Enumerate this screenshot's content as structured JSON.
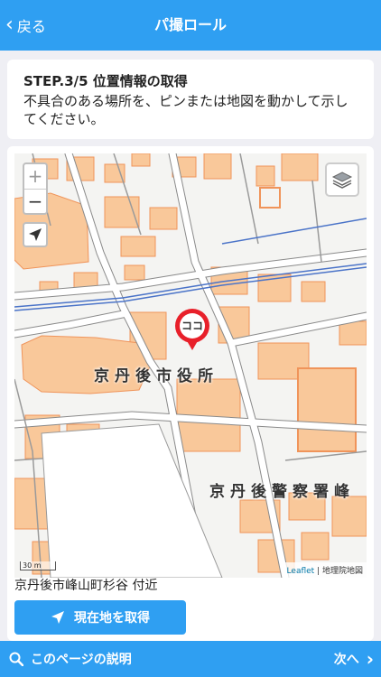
{
  "nav": {
    "back_label": "戻る",
    "title": "パ撮ロール"
  },
  "step": {
    "title": "STEP.3/5 位置情報の取得",
    "description": "不具合のある場所を、ピンまたは地図を動かして示してください。"
  },
  "map": {
    "zoom_in": "+",
    "zoom_out": "−",
    "marker_label": "ココ",
    "labels": {
      "city_hall": "京丹後市役所",
      "police": "京丹後警察署峰"
    },
    "scale_label": "30 m",
    "attribution_leaflet": "Leaflet",
    "attribution_gsi": "地理院地図",
    "colors": {
      "building": "#f9c89a",
      "building_edge": "#f0945a",
      "road": "#ffffff",
      "water": "#4a73c8"
    }
  },
  "address": "京丹後市峰山町杉谷 付近",
  "locate_button_label": "現在地を取得",
  "footer": {
    "help_label": "このページの説明",
    "next_label": "次へ"
  },
  "colors": {
    "accent": "#2f9ff2",
    "marker": "#e8202a"
  },
  "icons": [
    "chevron-left-icon",
    "layers-icon",
    "locate-arrow-icon",
    "navigation-arrow-icon",
    "search-icon",
    "chevron-right-icon"
  ]
}
